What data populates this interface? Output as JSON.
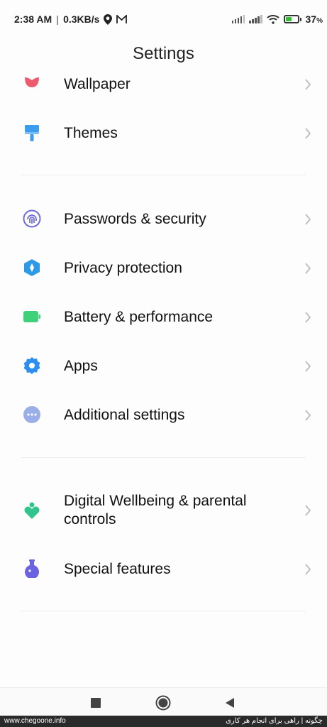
{
  "status_bar": {
    "time": "2:38 AM",
    "speed": "0.3KB/s",
    "battery": "37"
  },
  "title": "Settings",
  "items": [
    {
      "label": "Wallpaper",
      "icon": "tulip-icon"
    },
    {
      "label": "Themes",
      "icon": "paint-roller-icon"
    },
    {
      "label": "Passwords & security",
      "icon": "fingerprint-icon"
    },
    {
      "label": "Privacy protection",
      "icon": "privacy-shield-icon"
    },
    {
      "label": "Battery & performance",
      "icon": "battery-icon"
    },
    {
      "label": "Apps",
      "icon": "gear-icon"
    },
    {
      "label": "Additional settings",
      "icon": "more-dots-icon"
    },
    {
      "label": "Digital Wellbeing & parental controls",
      "icon": "wellbeing-heart-icon"
    },
    {
      "label": "Special features",
      "icon": "flask-icon"
    }
  ],
  "footer": {
    "left": "www.chegoone.info",
    "right": "چگونه | راهی برای انجام هر کاری"
  },
  "colors": {
    "wallpaper": "#ec5b6e",
    "themes": "#3c9cf0",
    "security": "#6f6cdc",
    "privacy": "#2e9ae6",
    "battery": "#3ed17a",
    "apps": "#2d8ef0",
    "additional": "#9aaee8",
    "wellbeing": "#31c48d",
    "special": "#6b63e0"
  }
}
